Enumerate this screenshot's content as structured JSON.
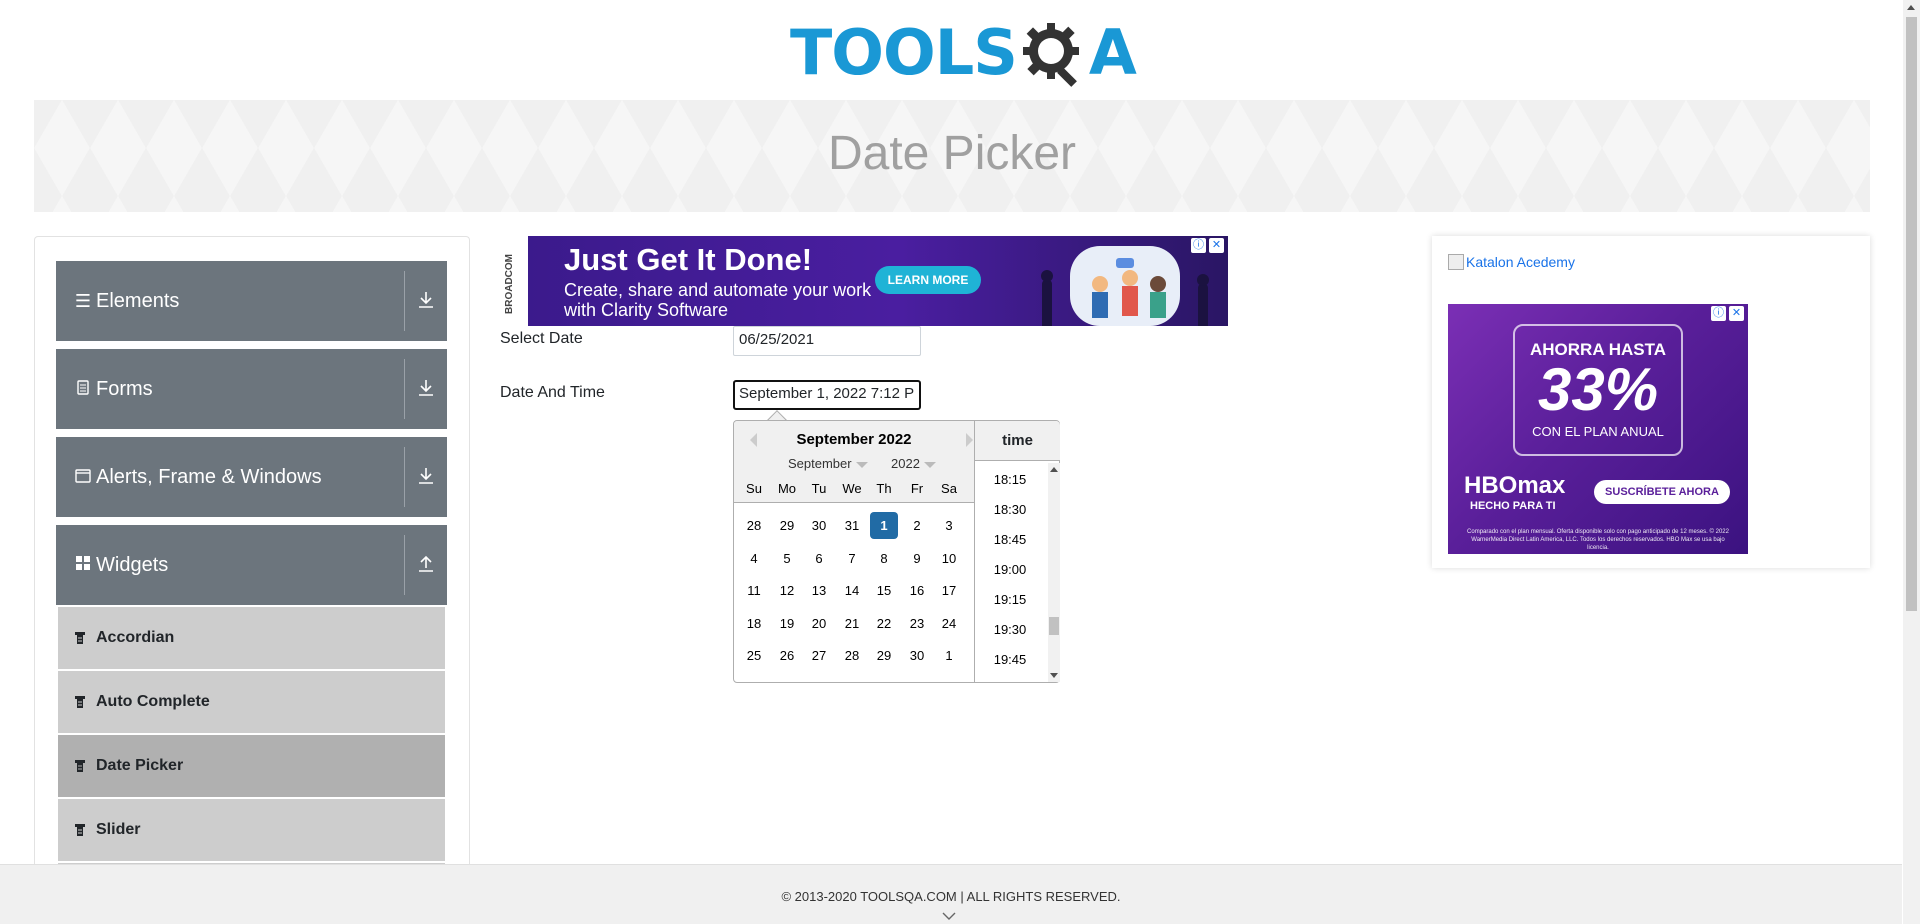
{
  "header": {
    "logo_text_left": "TOOLS",
    "logo_text_right": "A"
  },
  "page": {
    "title": "Date Picker"
  },
  "sidebar": {
    "groups": [
      {
        "label": "Elements",
        "icon": "hamburger-icon"
      },
      {
        "label": "Forms",
        "icon": "document-icon"
      },
      {
        "label": "Alerts, Frame & Windows",
        "icon": "window-icon"
      },
      {
        "label": "Widgets",
        "icon": "grid-icon"
      }
    ],
    "items": [
      {
        "label": "Accordian"
      },
      {
        "label": "Auto Complete"
      },
      {
        "label": "Date Picker"
      },
      {
        "label": "Slider"
      }
    ]
  },
  "ad_center": {
    "brand": "BROADCOM",
    "headline": "Just Get It Done!",
    "sub": "Create, share and automate your work with Clarity Software",
    "button": "LEARN MORE"
  },
  "form": {
    "select_date_label": "Select Date",
    "select_date_value": "06/25/2021",
    "date_time_label": "Date And Time",
    "date_time_value": "September 1, 2022 7:12 P"
  },
  "datepicker": {
    "header": "September 2022",
    "month_select": "September",
    "year_select": "2022",
    "weekdays": [
      "Su",
      "Mo",
      "Tu",
      "We",
      "Th",
      "Fr",
      "Sa"
    ],
    "weeks": [
      [
        "28",
        "29",
        "30",
        "31",
        "1",
        "2",
        "3"
      ],
      [
        "4",
        "5",
        "6",
        "7",
        "8",
        "9",
        "10"
      ],
      [
        "11",
        "12",
        "13",
        "14",
        "15",
        "16",
        "17"
      ],
      [
        "18",
        "19",
        "20",
        "21",
        "22",
        "23",
        "24"
      ],
      [
        "25",
        "26",
        "27",
        "28",
        "29",
        "30",
        "1"
      ]
    ],
    "selected_day": "1",
    "time_header": "time",
    "times": [
      "18:15",
      "18:30",
      "18:45",
      "19:00",
      "19:15",
      "19:30",
      "19:45"
    ]
  },
  "ad_right": {
    "alt_text": "Katalon Acedemy",
    "line1": "AHORRA HASTA",
    "percent": "33%",
    "line2": "CON EL PLAN ANUAL",
    "brand": "HBOmax",
    "brand_sub": "HECHO PARA TI",
    "cta": "SUSCRÍBETE AHORA",
    "fine_print": "Comparado con el plan mensual. Oferta disponible solo con pago anticipado de 12 meses. © 2022 WarnerMedia Direct Latin America, LLC. Todos los derechos reservados. HBO Max se usa bajo licencia."
  },
  "footer": {
    "text": "© 2013-2020 TOOLSQA.COM | ALL RIGHTS RESERVED."
  }
}
